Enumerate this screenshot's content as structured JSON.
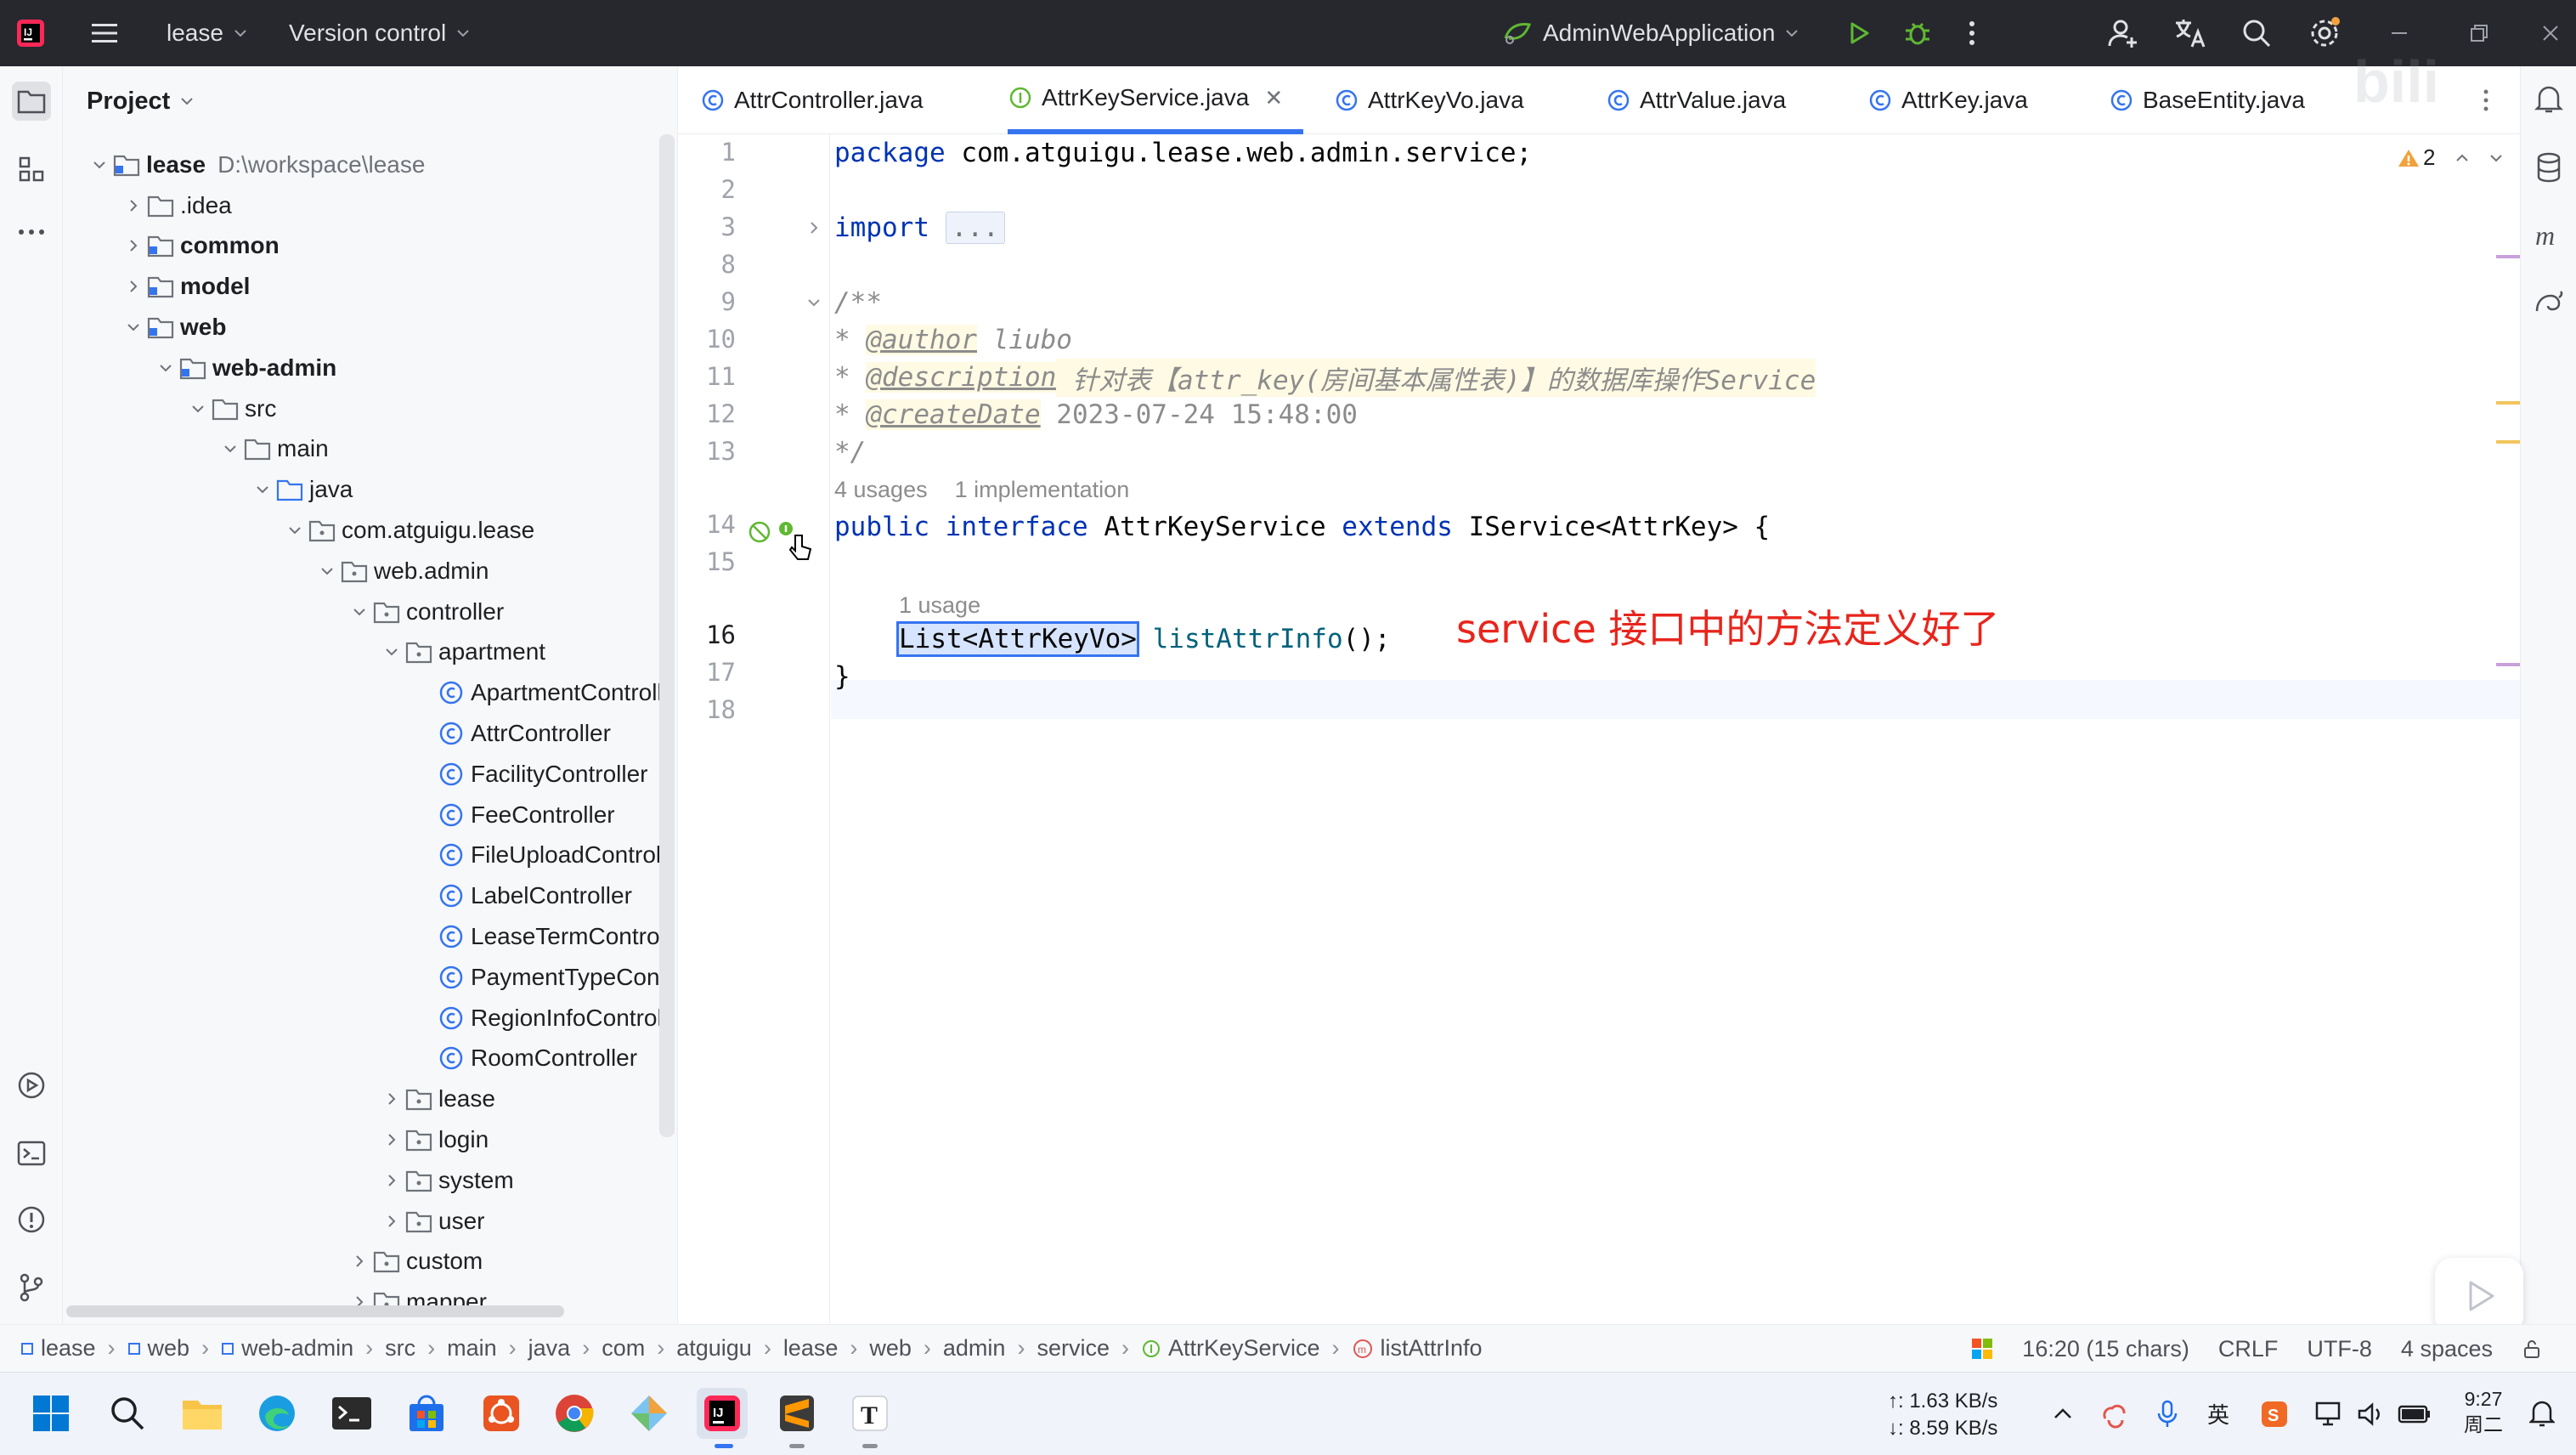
{
  "titlebar": {
    "project_name": "lease",
    "vcs_label": "Version control",
    "run_config": "AdminWebApplication"
  },
  "project_panel": {
    "title": "Project",
    "root": {
      "name": "lease",
      "path": "D:\\workspace\\lease"
    },
    "items": [
      {
        "label": ".idea"
      },
      {
        "label": "common"
      },
      {
        "label": "model"
      },
      {
        "label": "web"
      },
      {
        "label": "web-admin"
      },
      {
        "label": "src"
      },
      {
        "label": "main"
      },
      {
        "label": "java"
      },
      {
        "label": "com.atguigu.lease"
      },
      {
        "label": "web.admin"
      },
      {
        "label": "controller"
      },
      {
        "label": "apartment"
      },
      {
        "label": "ApartmentControll"
      },
      {
        "label": "AttrController"
      },
      {
        "label": "FacilityController"
      },
      {
        "label": "FeeController"
      },
      {
        "label": "FileUploadControll"
      },
      {
        "label": "LabelController"
      },
      {
        "label": "LeaseTermControl"
      },
      {
        "label": "PaymentTypeCont"
      },
      {
        "label": "RegionInfoControll"
      },
      {
        "label": "RoomController"
      },
      {
        "label": "lease"
      },
      {
        "label": "login"
      },
      {
        "label": "system"
      },
      {
        "label": "user"
      },
      {
        "label": "custom"
      },
      {
        "label": "mapper"
      }
    ]
  },
  "tabs": [
    {
      "label": "AttrController.java"
    },
    {
      "label": "AttrKeyService.java",
      "active": true
    },
    {
      "label": "AttrKeyVo.java"
    },
    {
      "label": "AttrValue.java"
    },
    {
      "label": "AttrKey.java"
    },
    {
      "label": "BaseEntity.java"
    }
  ],
  "editor": {
    "line_numbers": [
      "1",
      "2",
      "3",
      "8",
      "9",
      "10",
      "11",
      "12",
      "13",
      "14",
      "15",
      "16",
      "17",
      "18"
    ],
    "warnings_count": "2",
    "code": {
      "l1_kw": "package",
      "l1_rest": " com.atguigu.lease.web.admin.service;",
      "l3_kw": "import",
      "l3_fold": "...",
      "l9": "/**",
      "l10_star": "* ",
      "l10_tag": "@author",
      "l10_text": " liubo",
      "l11_star": "* ",
      "l11_tag": "@description",
      "l11_text": " 针对表【attr_key(房间基本属性表)】的数据库操作Service",
      "l12_star": "* ",
      "l12_tag": "@createDate",
      "l12_text": " 2023-07-24 15:48:00",
      "l13": "*/",
      "hint_usages": "4 usages",
      "hint_impl": "1 implementation",
      "l14_kw1": "public",
      "l14_kw2": "interface",
      "l14_name": "AttrKeyService",
      "l14_kw3": "extends",
      "l14_rest": "IService<AttrKey> {",
      "hint_usage2": "1 usage",
      "l16_type": "List<AttrKeyVo>",
      "l16_method": "listAttrInfo",
      "l16_rest": "();",
      "l17": "}"
    },
    "annotation": "service 接口中的方法定义好了"
  },
  "breadcrumbs": [
    "lease",
    "web",
    "web-admin",
    "src",
    "main",
    "java",
    "com",
    "atguigu",
    "lease",
    "web",
    "admin",
    "service",
    "AttrKeyService",
    "listAttrInfo"
  ],
  "status": {
    "position": "16:20 (15 chars)",
    "line_sep": "CRLF",
    "encoding": "UTF-8",
    "indent": "4 spaces"
  },
  "taskbar": {
    "upload": "↑: 1.63 KB/s",
    "download": "↓: 8.59 KB/s",
    "time": "9:27",
    "day": "周二"
  }
}
